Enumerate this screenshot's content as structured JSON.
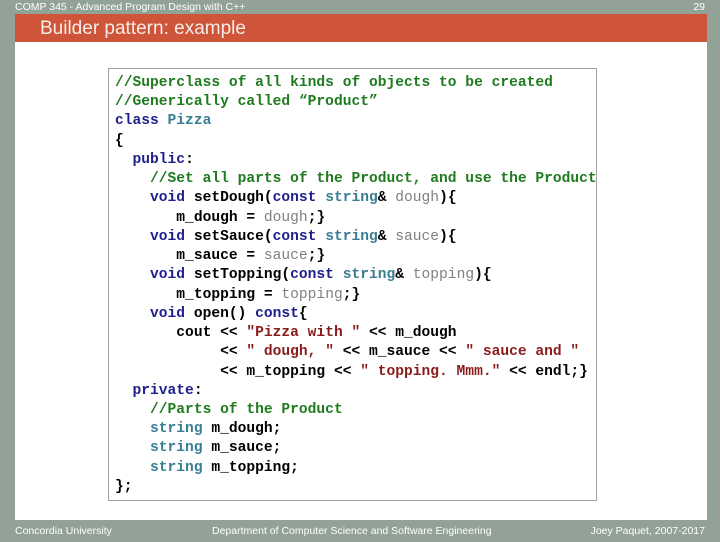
{
  "header": {
    "course": "COMP 345 - Advanced Program Design with C++",
    "slide_number": "29",
    "title": "Builder pattern: example"
  },
  "colors": {
    "frame": "#93a296",
    "title_bar": "#cf553a",
    "comment": "#1e7b1e",
    "keyword": "#1f1f8c",
    "type": "#3a7e94",
    "parameter": "#808080",
    "string": "#8b1c1c"
  },
  "code": {
    "language": "C++",
    "lines": [
      [
        {
          "t": "com",
          "s": "//Superclass of all kinds of objects to be created"
        }
      ],
      [
        {
          "t": "com",
          "s": "//Generically called “Product”"
        }
      ],
      [
        {
          "t": "kw",
          "s": "class "
        },
        {
          "t": "type",
          "s": "Pizza"
        }
      ],
      [
        {
          "t": "txt",
          "s": "{"
        }
      ],
      [
        {
          "t": "txt",
          "s": "  "
        },
        {
          "t": "kw",
          "s": "public"
        },
        {
          "t": "txt",
          "s": ":"
        }
      ],
      [
        {
          "t": "txt",
          "s": "    "
        },
        {
          "t": "com",
          "s": "//Set all parts of the Product, and use the Product"
        }
      ],
      [
        {
          "t": "txt",
          "s": "    "
        },
        {
          "t": "kw",
          "s": "void"
        },
        {
          "t": "txt",
          "s": " setDough("
        },
        {
          "t": "kw",
          "s": "const"
        },
        {
          "t": "txt",
          "s": " "
        },
        {
          "t": "type",
          "s": "string"
        },
        {
          "t": "txt",
          "s": "& "
        },
        {
          "t": "par",
          "s": "dough"
        },
        {
          "t": "txt",
          "s": "){"
        }
      ],
      [
        {
          "t": "txt",
          "s": "       m_dough = "
        },
        {
          "t": "par",
          "s": "dough"
        },
        {
          "t": "txt",
          "s": ";}"
        }
      ],
      [
        {
          "t": "txt",
          "s": "    "
        },
        {
          "t": "kw",
          "s": "void"
        },
        {
          "t": "txt",
          "s": " setSauce("
        },
        {
          "t": "kw",
          "s": "const"
        },
        {
          "t": "txt",
          "s": " "
        },
        {
          "t": "type",
          "s": "string"
        },
        {
          "t": "txt",
          "s": "& "
        },
        {
          "t": "par",
          "s": "sauce"
        },
        {
          "t": "txt",
          "s": "){"
        }
      ],
      [
        {
          "t": "txt",
          "s": "       m_sauce = "
        },
        {
          "t": "par",
          "s": "sauce"
        },
        {
          "t": "txt",
          "s": ";}"
        }
      ],
      [
        {
          "t": "txt",
          "s": "    "
        },
        {
          "t": "kw",
          "s": "void"
        },
        {
          "t": "txt",
          "s": " setTopping("
        },
        {
          "t": "kw",
          "s": "const"
        },
        {
          "t": "txt",
          "s": " "
        },
        {
          "t": "type",
          "s": "string"
        },
        {
          "t": "txt",
          "s": "& "
        },
        {
          "t": "par",
          "s": "topping"
        },
        {
          "t": "txt",
          "s": "){"
        }
      ],
      [
        {
          "t": "txt",
          "s": "       m_topping = "
        },
        {
          "t": "par",
          "s": "topping"
        },
        {
          "t": "txt",
          "s": ";}"
        }
      ],
      [
        {
          "t": "txt",
          "s": "    "
        },
        {
          "t": "kw",
          "s": "void"
        },
        {
          "t": "txt",
          "s": " open() "
        },
        {
          "t": "kw",
          "s": "const"
        },
        {
          "t": "txt",
          "s": "{"
        }
      ],
      [
        {
          "t": "txt",
          "s": "       cout << "
        },
        {
          "t": "str",
          "s": "\"Pizza with \""
        },
        {
          "t": "txt",
          "s": " << m_dough"
        }
      ],
      [
        {
          "t": "txt",
          "s": "            << "
        },
        {
          "t": "str",
          "s": "\" dough, \""
        },
        {
          "t": "txt",
          "s": " << m_sauce << "
        },
        {
          "t": "str",
          "s": "\" sauce and \""
        }
      ],
      [
        {
          "t": "txt",
          "s": "            << m_topping << "
        },
        {
          "t": "str",
          "s": "\" topping. Mmm.\""
        },
        {
          "t": "txt",
          "s": " << endl;}"
        }
      ],
      [
        {
          "t": "txt",
          "s": "  "
        },
        {
          "t": "kw",
          "s": "private"
        },
        {
          "t": "txt",
          "s": ":"
        }
      ],
      [
        {
          "t": "txt",
          "s": "    "
        },
        {
          "t": "com",
          "s": "//Parts of the Product"
        }
      ],
      [
        {
          "t": "txt",
          "s": "    "
        },
        {
          "t": "type",
          "s": "string"
        },
        {
          "t": "txt",
          "s": " m_dough;"
        }
      ],
      [
        {
          "t": "txt",
          "s": "    "
        },
        {
          "t": "type",
          "s": "string"
        },
        {
          "t": "txt",
          "s": " m_sauce;"
        }
      ],
      [
        {
          "t": "txt",
          "s": "    "
        },
        {
          "t": "type",
          "s": "string"
        },
        {
          "t": "txt",
          "s": " m_topping;"
        }
      ],
      [
        {
          "t": "txt",
          "s": "};"
        }
      ]
    ]
  },
  "footer": {
    "left": "Concordia University",
    "center": "Department of Computer Science and Software Engineering",
    "right": "Joey Paquet, 2007-2017"
  }
}
